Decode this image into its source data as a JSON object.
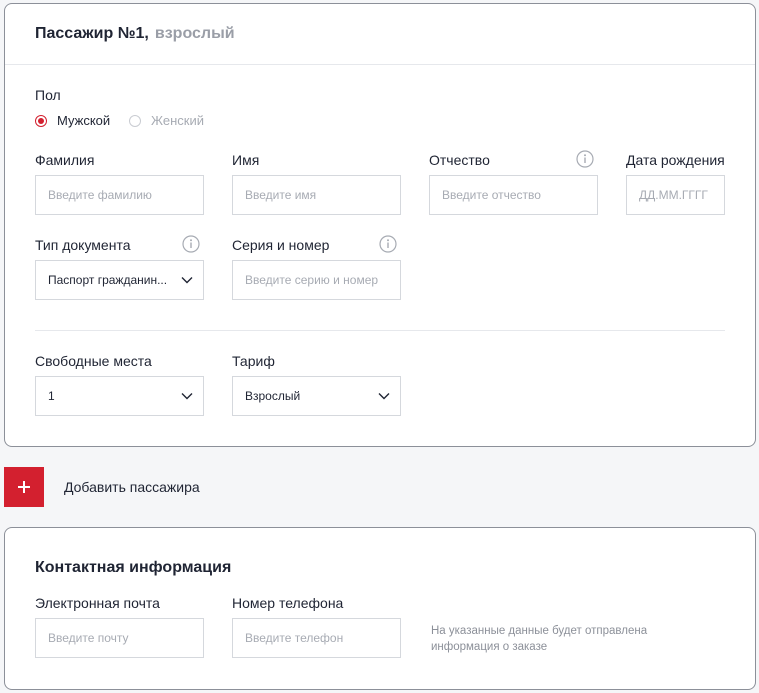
{
  "passenger": {
    "title": "Пассажир №1,",
    "subtitle": "взрослый",
    "gender_label": "Пол",
    "gender_options": [
      {
        "label": "Мужской",
        "selected": true
      },
      {
        "label": "Женский",
        "selected": false
      }
    ],
    "fields": {
      "last_name": {
        "label": "Фамилия",
        "placeholder": "Введите фамилию"
      },
      "first_name": {
        "label": "Имя",
        "placeholder": "Введите имя"
      },
      "patronymic": {
        "label": "Отчество",
        "placeholder": "Введите отчество"
      },
      "birth_date": {
        "label": "Дата рождения",
        "placeholder": "ДД.ММ.ГГГГ"
      },
      "document_type": {
        "label": "Тип документа",
        "value": "Паспорт гражданин..."
      },
      "document_number": {
        "label": "Серия и номер",
        "placeholder": "Введите серию и номер"
      },
      "seats": {
        "label": "Свободные места",
        "value": "1"
      },
      "tariff": {
        "label": "Тариф",
        "value": "Взрослый"
      }
    }
  },
  "add_passenger": {
    "label": "Добавить пассажира",
    "icon": "plus-icon"
  },
  "contact": {
    "title": "Контактная информация",
    "email": {
      "label": "Электронная почта",
      "placeholder": "Введите почту"
    },
    "phone": {
      "label": "Номер телефона",
      "placeholder": "Введите телефон"
    },
    "note_line1": "На указанные данные будет отправлена",
    "note_line2": "информация о заказе"
  },
  "colors": {
    "accent": "#d3202f",
    "border": "#8c9099",
    "background": "#f5f6f8"
  }
}
